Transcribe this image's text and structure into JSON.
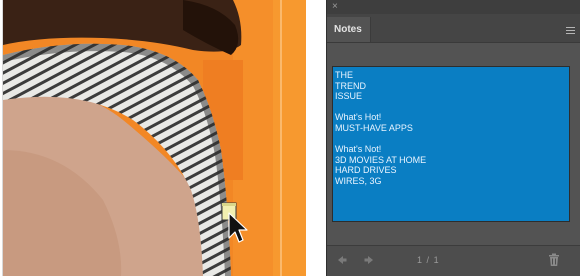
{
  "canvas": {
    "description_icon": "note-marker-icon",
    "cursor_icon": "arrow-cursor-icon"
  },
  "notes_panel": {
    "close_glyph": "×",
    "tab_label": "Notes",
    "menu_icon": "panel-menu-icon",
    "note_lines": [
      "THE",
      "TREND",
      "ISSUE",
      "",
      "What's Hot!",
      "MUST-HAVE APPS",
      "",
      "What's Not!",
      "3D MOVIES AT HOME",
      "HARD DRIVES",
      "WIRES, 3G"
    ],
    "footer": {
      "prev_icon": "arrow-left-icon",
      "next_icon": "arrow-right-icon",
      "page_current": "1",
      "page_separator": "/",
      "page_total": "1",
      "page_display": "1 / 1",
      "delete_icon": "trash-icon"
    }
  },
  "colors": {
    "note_bg": "#0a7ec3",
    "panel_bg": "#535353",
    "canvas_orange": "#f48a24"
  }
}
